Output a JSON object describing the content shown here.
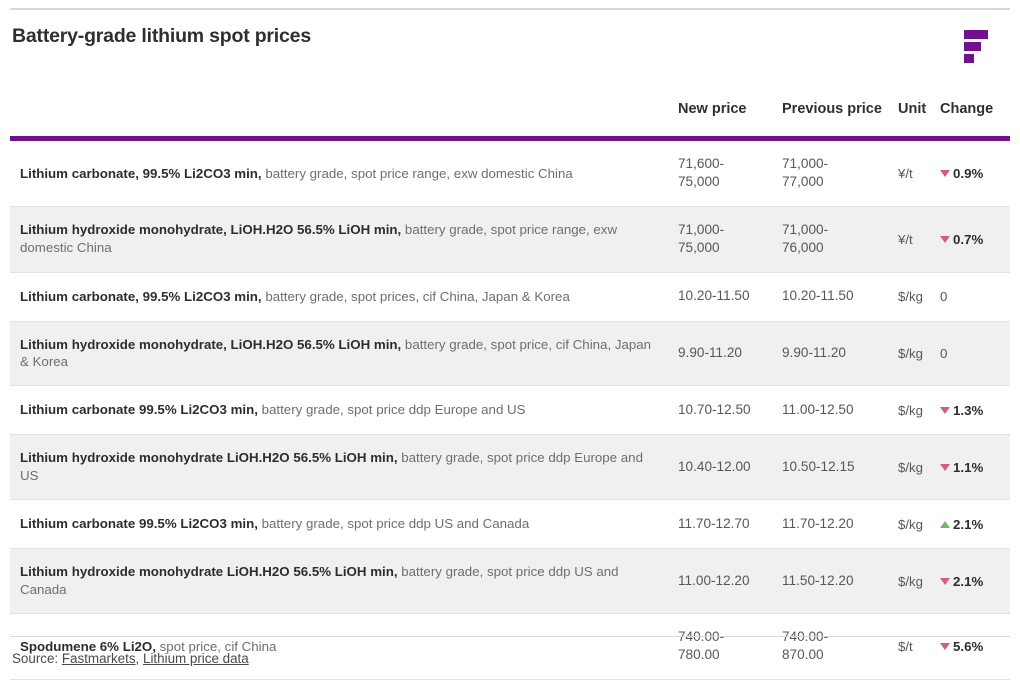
{
  "header": {
    "title": "Battery-grade lithium spot prices",
    "logo_name": "fastmarkets-f-logo"
  },
  "table": {
    "columns": {
      "description": "",
      "new_price": "New price",
      "previous_price": "Previous price",
      "unit": "Unit",
      "change": "Change"
    },
    "accent_color": "#70108c",
    "down_color": "#d45c84",
    "up_color": "#6cb96c",
    "rows": [
      {
        "name_bold": "Lithium carbonate, 99.5% Li2CO3 min,",
        "name_rest": " battery grade, spot price range, exw domestic China",
        "new_price": "71,600-\n75,000",
        "previous_price": "71,000-\n77,000",
        "unit": "¥/t",
        "change": "0.9%",
        "direction": "down"
      },
      {
        "name_bold": "Lithium hydroxide monohydrate, LiOH.H2O 56.5% LiOH min,",
        "name_rest": " battery grade, spot price range, exw domestic China",
        "new_price": "71,000-\n75,000",
        "previous_price": "71,000-\n76,000",
        "unit": "¥/t",
        "change": "0.7%",
        "direction": "down"
      },
      {
        "name_bold": "Lithium carbonate, 99.5% Li2CO3 min,",
        "name_rest": " battery grade, spot prices, cif China, Japan & Korea",
        "new_price": "10.20-11.50",
        "previous_price": "10.20-11.50",
        "unit": "$/kg",
        "change": "0",
        "direction": "flat"
      },
      {
        "name_bold": "Lithium hydroxide monohydrate, LiOH.H2O 56.5% LiOH min,",
        "name_rest": " battery grade, spot price, cif China, Japan & Korea",
        "new_price": "9.90-11.20",
        "previous_price": "9.90-11.20",
        "unit": "$/kg",
        "change": "0",
        "direction": "flat"
      },
      {
        "name_bold": "Lithium carbonate 99.5% Li2CO3 min,",
        "name_rest": " battery grade, spot price ddp Europe and US",
        "new_price": "10.70-12.50",
        "previous_price": "11.00-12.50",
        "unit": "$/kg",
        "change": "1.3%",
        "direction": "down"
      },
      {
        "name_bold": "Lithium hydroxide monohydrate LiOH.H2O 56.5% LiOH min,",
        "name_rest": " battery grade, spot price ddp Europe and US",
        "new_price": "10.40-12.00",
        "previous_price": "10.50-12.15",
        "unit": "$/kg",
        "change": "1.1%",
        "direction": "down"
      },
      {
        "name_bold": "Lithium carbonate 99.5% Li2CO3 min,",
        "name_rest": " battery grade, spot price ddp US and Canada",
        "new_price": "11.70-12.70",
        "previous_price": "11.70-12.20",
        "unit": "$/kg",
        "change": "2.1%",
        "direction": "up"
      },
      {
        "name_bold": "Lithium hydroxide monohydrate LiOH.H2O 56.5% LiOH min,",
        "name_rest": " battery grade, spot price ddp US and Canada",
        "new_price": "11.00-12.20",
        "previous_price": "11.50-12.20",
        "unit": "$/kg",
        "change": "2.1%",
        "direction": "down"
      },
      {
        "name_bold": "Spodumene 6% Li2O,",
        "name_rest": " spot price, cif China",
        "new_price": "740.00-\n780.00",
        "previous_price": "740.00-\n870.00",
        "unit": "$/t",
        "change": "5.6%",
        "direction": "down"
      }
    ]
  },
  "footer": {
    "prefix": "Source: ",
    "link1": "Fastmarkets",
    "separator": ", ",
    "link2": "Lithium price data"
  }
}
